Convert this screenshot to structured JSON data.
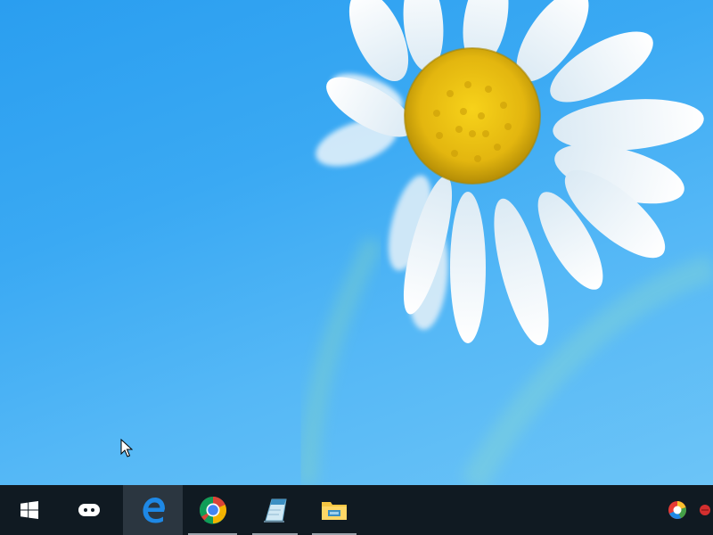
{
  "desktop": {
    "wallpaper": "daisy-wallpaper",
    "cursor": "arrow-cursor"
  },
  "taskbar": {
    "background": "#101a22",
    "buttons": [
      {
        "icon": "windows-start-icon",
        "active": false,
        "open": false
      },
      {
        "icon": "task-view-icon",
        "active": false,
        "open": false
      },
      {
        "icon": "edge-browser-icon",
        "active": true,
        "open": false
      },
      {
        "icon": "chrome-icon",
        "active": false,
        "open": true
      },
      {
        "icon": "notepad-icon",
        "active": false,
        "open": true
      },
      {
        "icon": "file-explorer-icon",
        "active": false,
        "open": true
      }
    ],
    "tray": [
      {
        "icon": "color-picker-tray-icon"
      },
      {
        "icon": "red-dot-tray-icon"
      }
    ]
  }
}
